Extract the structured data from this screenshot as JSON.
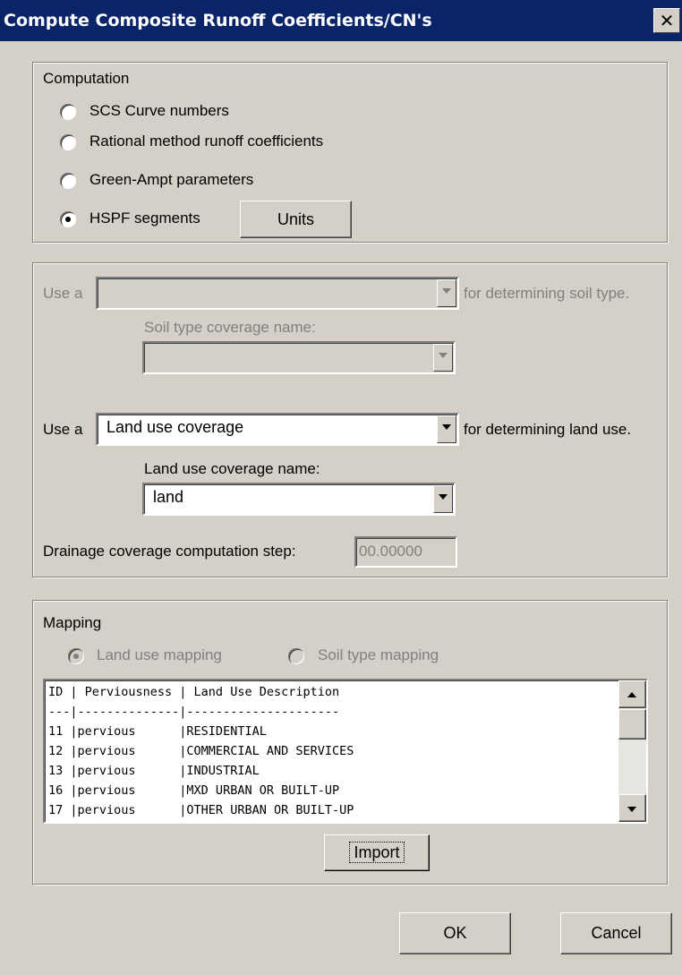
{
  "window": {
    "title": "Compute Composite Runoff Coefficients/CN's",
    "close_symbol": "✕"
  },
  "computation": {
    "legend": "Computation",
    "options": [
      {
        "label": "SCS Curve numbers",
        "checked": false
      },
      {
        "label": "Rational method runoff coefficients",
        "checked": false
      },
      {
        "label": "Green-Ampt parameters",
        "checked": false
      },
      {
        "label": "HSPF segments",
        "checked": true
      }
    ],
    "units_button": "Units"
  },
  "coverage": {
    "soil": {
      "prefix": "Use a",
      "value": "",
      "suffix": "for determining soil type.",
      "name_label": "Soil type coverage name:",
      "name_value": ""
    },
    "land": {
      "prefix": "Use a",
      "value": "Land use coverage",
      "suffix": "for determining land use.",
      "name_label": "Land use coverage name:",
      "name_value": "land"
    },
    "step_label": "Drainage coverage computation step:",
    "step_value": "00.00000"
  },
  "mapping": {
    "legend": "Mapping",
    "land_use_mapping": "Land use mapping",
    "soil_type_mapping": "Soil type mapping",
    "list_lines": [
      "ID | Perviousness | Land Use Description",
      "---|--------------|---------------------",
      "11 |pervious      |RESIDENTIAL",
      "12 |pervious      |COMMERCIAL AND SERVICES",
      "13 |pervious      |INDUSTRIAL",
      "16 |pervious      |MXD URBAN OR BUILT-UP",
      "17 |pervious      |OTHER URBAN OR BUILT-UP"
    ],
    "import_button": "Import"
  },
  "footer": {
    "ok_button": "OK",
    "cancel_button": "Cancel"
  }
}
